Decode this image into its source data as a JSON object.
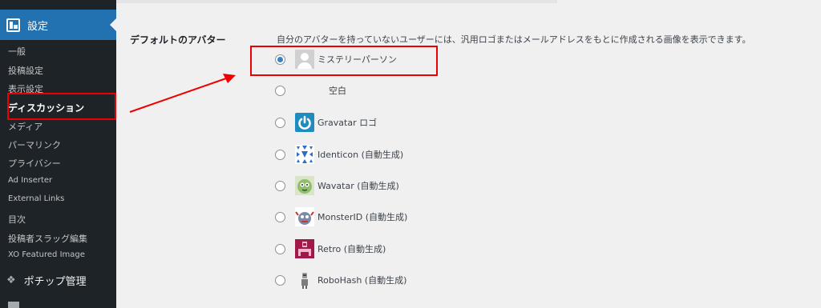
{
  "sidebar": {
    "active_menu": "設定",
    "items": [
      "一般",
      "投稿設定",
      "表示設定",
      "ディスカッション",
      "メディア",
      "パーマリンク",
      "プライバシー",
      "Ad Inserter",
      "External Links",
      "目次",
      "投稿者スラッグ編集",
      "XO Featured Image"
    ],
    "current_index": 3,
    "next_menu": "ポチップ管理"
  },
  "settings": {
    "field_label": "デフォルトのアバター",
    "description": "自分のアバターを持っていないユーザーには、汎用ロゴまたはメールアドレスをもとに作成される画像を表示できます。",
    "options": [
      {
        "label": "ミステリーパーソン",
        "checked": true
      },
      {
        "label": "空白",
        "checked": false
      },
      {
        "label": "Gravatar ロゴ",
        "checked": false
      },
      {
        "label": "Identicon (自動生成)",
        "checked": false
      },
      {
        "label": "Wavatar (自動生成)",
        "checked": false
      },
      {
        "label": "MonsterID (自動生成)",
        "checked": false
      },
      {
        "label": "Retro (自動生成)",
        "checked": false
      },
      {
        "label": "RoboHash (自動生成)",
        "checked": false
      }
    ]
  },
  "colors": {
    "sidebar_bg": "#1d2327",
    "active_bg": "#2271b1",
    "annotation": "#e00000",
    "radio_accent": "#3582c4"
  }
}
